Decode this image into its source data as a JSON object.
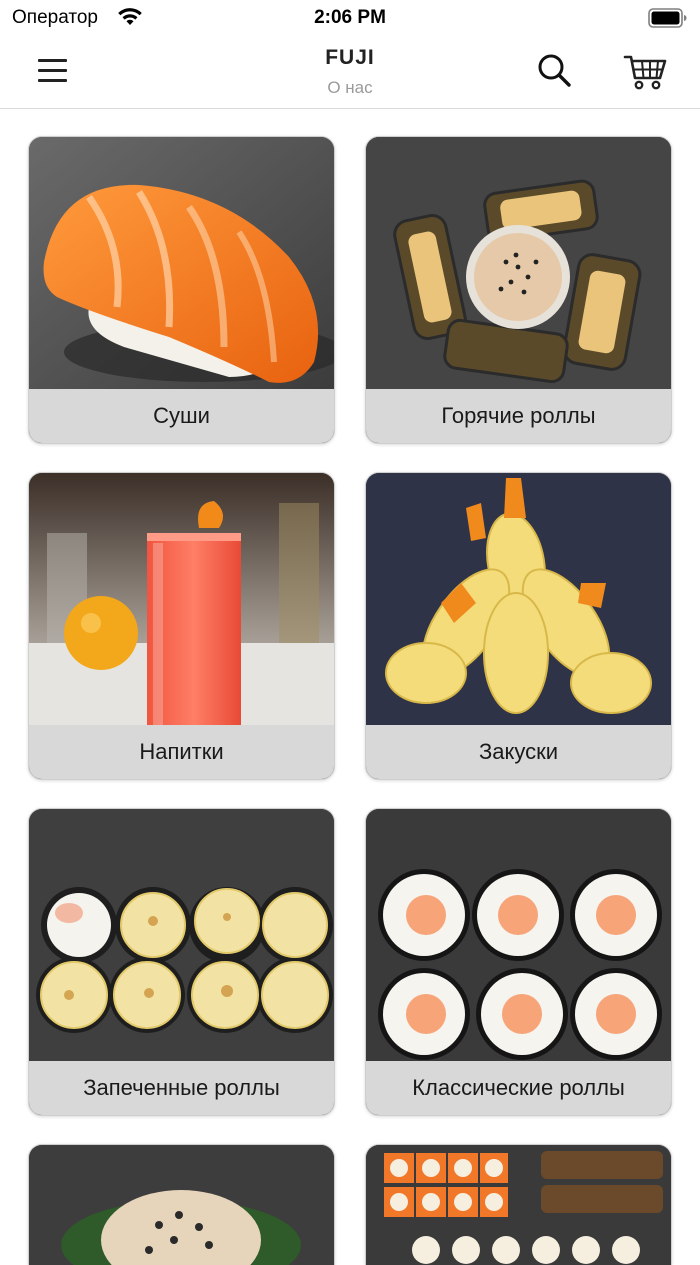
{
  "status_bar": {
    "carrier": "Оператор",
    "time": "2:06 PM",
    "wifi_icon": "wifi-icon",
    "battery_icon": "battery-full-icon"
  },
  "header": {
    "title": "FUJI",
    "subtitle": "О нас",
    "menu_icon": "hamburger-menu-icon",
    "search_icon": "search-icon",
    "cart_icon": "cart-icon"
  },
  "categories": [
    {
      "label": "Суши",
      "image": "salmon-nigiri-photo"
    },
    {
      "label": "Горячие роллы",
      "image": "hot-rolls-photo"
    },
    {
      "label": "Напитки",
      "image": "drinks-photo"
    },
    {
      "label": "Закуски",
      "image": "tempura-shrimp-photo"
    },
    {
      "label": "Запеченные роллы",
      "image": "baked-rolls-photo"
    },
    {
      "label": "Классические роллы",
      "image": "classic-rolls-photo"
    },
    {
      "label": "",
      "image": "poke-bowl-photo"
    },
    {
      "label": "",
      "image": "roll-sets-photo"
    }
  ],
  "colors": {
    "label_background": "#e4e4e4",
    "subtitle": "#9a9a9a",
    "divider": "#d9d9d9"
  }
}
